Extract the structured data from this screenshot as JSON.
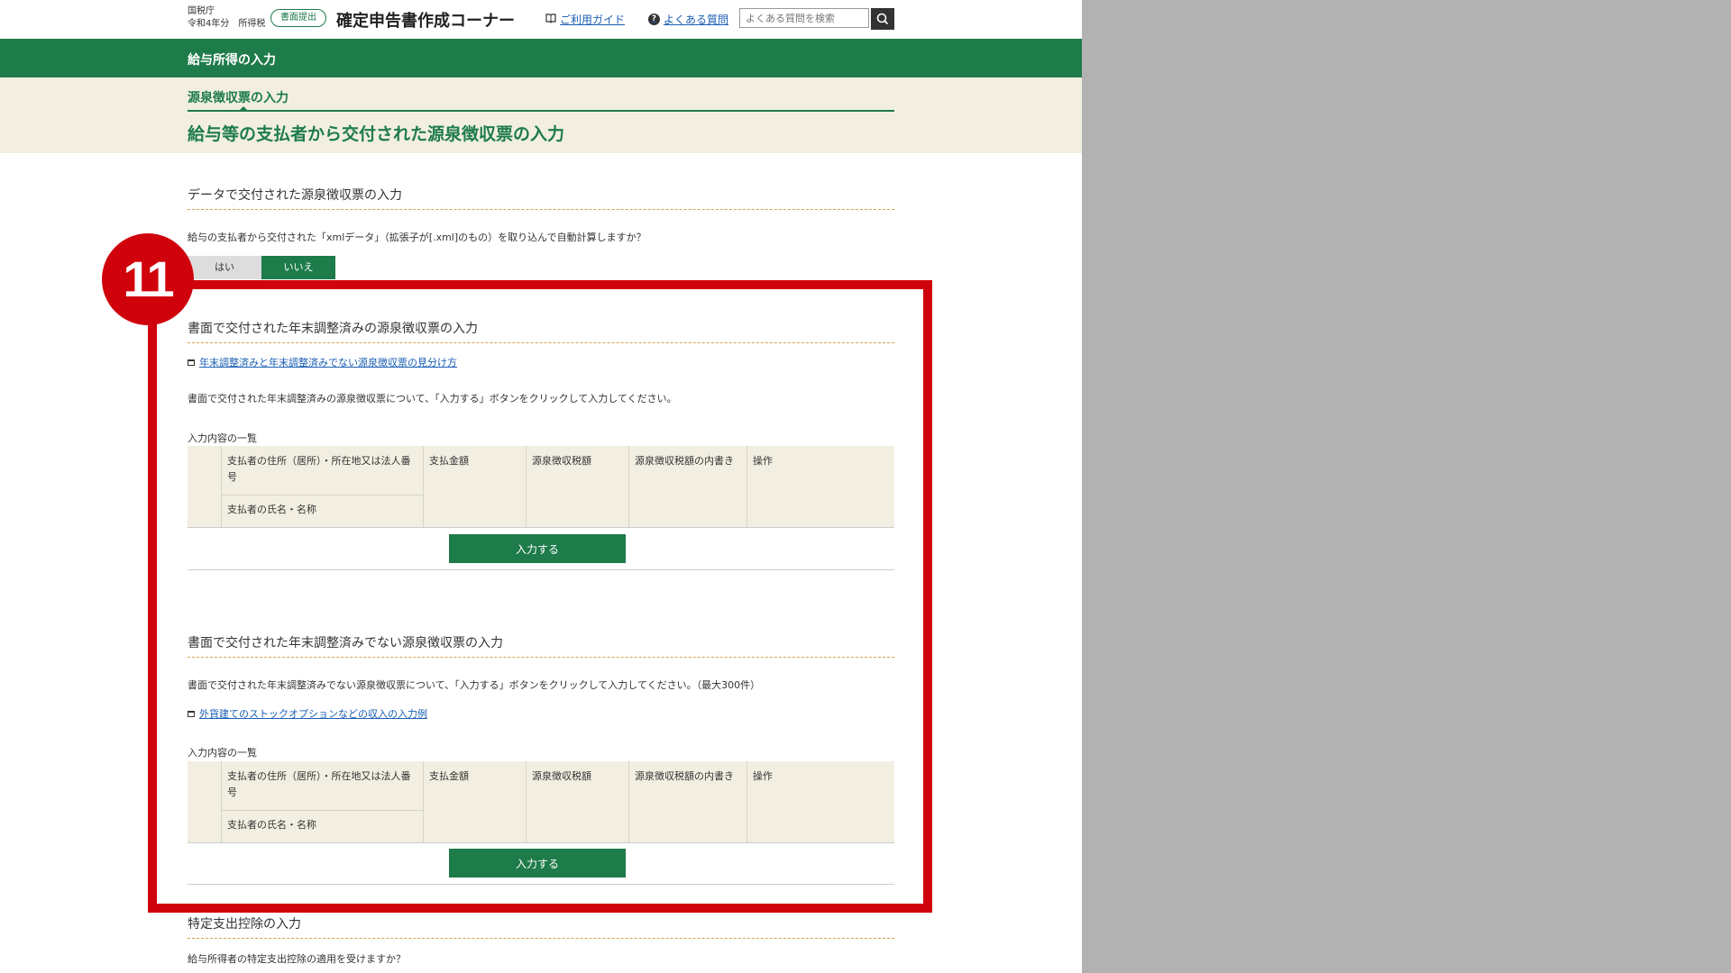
{
  "header": {
    "agency": "国税庁",
    "year_tax": "令和4年分　所得税",
    "badge": "書面提出",
    "title": "確定申告書作成コーナー",
    "guide_link": "ご利用ガイド",
    "faq_link": "よくある質問",
    "search_placeholder": "よくある質問を検索",
    "accent": "#1e7b4a"
  },
  "band": {
    "title": "給与所得の入力"
  },
  "step": {
    "label": "源泉徴収票の入力",
    "page_title": "給与等の支払者から交付された源泉徴収票の入力"
  },
  "data_section": {
    "title": "データで交付された源泉徴収票の入力",
    "question": "給与の支払者から交付された「xmlデータ」（拡張子が[.xml]のもの）を取り込んで自動計算しますか？",
    "yes": "はい",
    "no": "いいえ"
  },
  "annotation": {
    "number": "11",
    "color": "#d0020c"
  },
  "sections": [
    {
      "title": "書面で交付された年末調整済みの源泉徴収票の入力",
      "link": "年末調整済みと年末調整済みでない源泉徴収票の見分け方",
      "description": "書面で交付された年末調整済みの源泉徴収票について、「入力する」ボタンをクリックして入力してください。",
      "list_label": "入力内容の一覧",
      "columns": {
        "address": "支払者の住所（居所）・所在地又は法人番号",
        "name": "支払者の氏名・名称",
        "amount": "支払金額",
        "tax": "源泉徴収税額",
        "tax_detail": "源泉徴収税額の内書き",
        "ops": "操作"
      },
      "button": "入力する"
    },
    {
      "title": "書面で交付された年末調整済みでない源泉徴収票の入力",
      "description": "書面で交付された年末調整済みでない源泉徴収票について、「入力する」ボタンをクリックして入力してください。（最大300件）",
      "link": "外貨建てのストックオプションなどの収入の入力例",
      "list_label": "入力内容の一覧",
      "columns": {
        "address": "支払者の住所（居所）・所在地又は法人番号",
        "name": "支払者の氏名・名称",
        "amount": "支払金額",
        "tax": "源泉徴収税額",
        "tax_detail": "源泉徴収税額の内書き",
        "ops": "操作"
      },
      "button": "入力する"
    }
  ],
  "specific_section": {
    "title": "特定支出控除の入力",
    "question": "給与所得者の特定支出控除の適用を受けますか？"
  }
}
